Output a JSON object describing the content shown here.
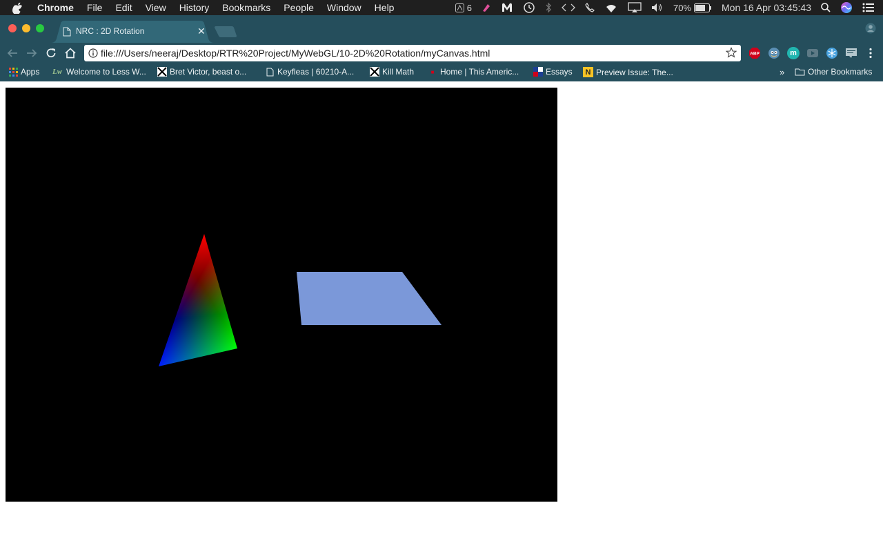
{
  "menubar": {
    "app_name": "Chrome",
    "items": [
      "File",
      "Edit",
      "View",
      "History",
      "Bookmarks",
      "People",
      "Window",
      "Help"
    ],
    "adobe_count": "6",
    "battery": "70%",
    "datetime": "Mon 16 Apr  03:45:43"
  },
  "tabs": [
    {
      "title": "NRC : 2D Rotation",
      "active": true
    }
  ],
  "omnibox": {
    "url": "file:///Users/neeraj/Desktop/RTR%20Project/MyWebGL/10-2D%20Rotation/myCanvas.html"
  },
  "extensions": [
    {
      "name": "ABP",
      "color": "#d0021b"
    },
    {
      "name": "ghostery-icon",
      "color": "#6fa3c9"
    },
    {
      "name": "m",
      "color": "#21b6b0"
    },
    {
      "name": "video-icon",
      "color": "#5e7a86"
    },
    {
      "name": "snowflake-icon",
      "color": "#4aa3df"
    },
    {
      "name": "comment-icon",
      "color": "#b5c7cd"
    }
  ],
  "bookmarks": {
    "items": [
      {
        "label": "Apps",
        "icon": "apps-grid-icon"
      },
      {
        "label": "Welcome to Less W...",
        "icon": "lw-icon"
      },
      {
        "label": "Bret Victor, beast o...",
        "icon": "bret-icon"
      },
      {
        "label": "Keyfleas | 60210-A...",
        "icon": "page-icon"
      },
      {
        "label": "Kill Math",
        "icon": "bret-icon"
      },
      {
        "label": "Home | This Americ...",
        "icon": "tal-icon"
      },
      {
        "label": "Essays",
        "icon": "essays-icon"
      },
      {
        "label": "Preview Issue: The...",
        "icon": "n-icon"
      }
    ],
    "other": "Other Bookmarks"
  },
  "canvas": {
    "background": "#000000",
    "triangle_colors": [
      "#ff0000",
      "#0000ff",
      "#00ff00"
    ],
    "quad_color": "#7b98d9"
  }
}
